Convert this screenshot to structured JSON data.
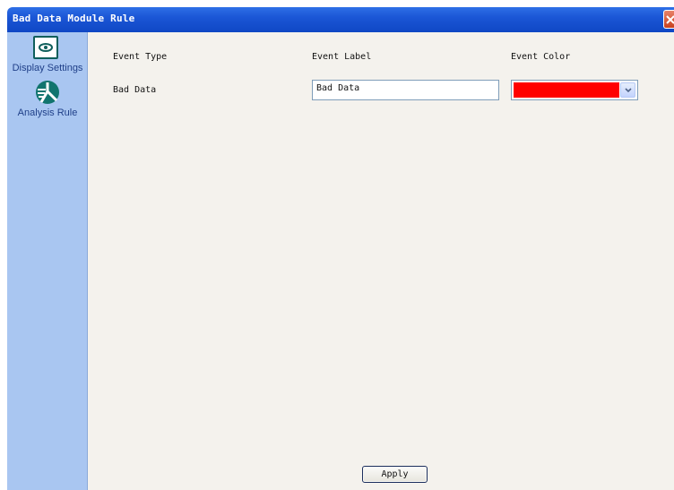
{
  "window": {
    "title": "Bad Data Module Rule"
  },
  "sidebar": {
    "items": [
      {
        "label": "Display Settings",
        "icon": "display-settings-icon"
      },
      {
        "label": "Analysis Rule",
        "icon": "analysis-rule-icon"
      }
    ]
  },
  "table": {
    "headers": {
      "event_type": "Event Type",
      "event_label": "Event Label",
      "event_color": "Event Color"
    },
    "rows": [
      {
        "event_type": "Bad Data",
        "event_label": "Bad Data",
        "event_color": "#ff0000"
      }
    ]
  },
  "actions": {
    "apply_label": "Apply"
  },
  "colors": {
    "titlebar": "#1b56d6",
    "sidebar": "#a9c6f1",
    "content_bg": "#f4f2ed",
    "icon_teal": "#0f5f5c"
  }
}
